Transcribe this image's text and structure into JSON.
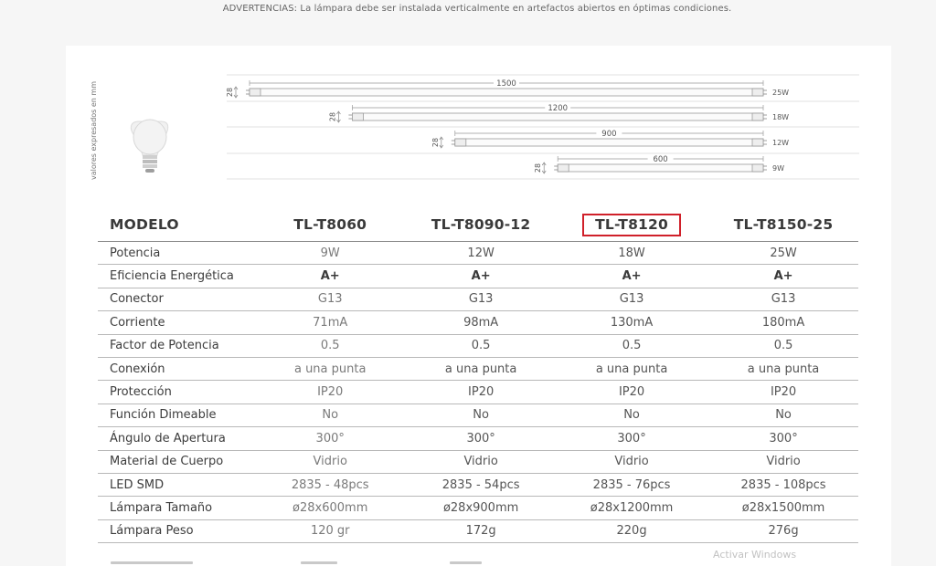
{
  "warning": {
    "text": "ADVERTENCIAS: La lámpara debe ser instalada verticalmente en artefactos abiertos en óptimas condiciones."
  },
  "diagram": {
    "side_label": "valores expresados en mm",
    "tubes": [
      {
        "diameter": "28",
        "length": "1500",
        "watt": "25W"
      },
      {
        "diameter": "28",
        "length": "1200",
        "watt": "18W"
      },
      {
        "diameter": "28",
        "length": "900",
        "watt": "12W"
      },
      {
        "diameter": "28",
        "length": "600",
        "watt": "9W"
      }
    ]
  },
  "table": {
    "header_label": "MODELO",
    "models": [
      "TL-T8060",
      "TL-T8090-12",
      "TL-T8120",
      "TL-T8150-25"
    ],
    "highlighted_model": "TL-T8120",
    "highlight_color": "#d0202a",
    "rows": [
      {
        "label": "Potencia",
        "values": [
          "9W",
          "12W",
          "18W",
          "25W"
        ]
      },
      {
        "label": "Eficiencia Energética",
        "values": [
          "A+",
          "A+",
          "A+",
          "A+"
        ],
        "bold": true
      },
      {
        "label": "Conector",
        "values": [
          "G13",
          "G13",
          "G13",
          "G13"
        ]
      },
      {
        "label": "Corriente",
        "values": [
          "71mA",
          "98mA",
          "130mA",
          "180mA"
        ]
      },
      {
        "label": "Factor de Potencia",
        "values": [
          "0.5",
          "0.5",
          "0.5",
          "0.5"
        ]
      },
      {
        "label": "Conexión",
        "values": [
          "a una punta",
          "a una punta",
          "a una punta",
          "a una punta"
        ]
      },
      {
        "label": "Protección",
        "values": [
          "IP20",
          "IP20",
          "IP20",
          "IP20"
        ]
      },
      {
        "label": "Función Dimeable",
        "values": [
          "No",
          "No",
          "No",
          "No"
        ]
      },
      {
        "label": "Ángulo de Apertura",
        "values": [
          "300°",
          "300°",
          "300°",
          "300°"
        ]
      },
      {
        "label": "Material de Cuerpo",
        "values": [
          "Vidrio",
          "Vidrio",
          "Vidrio",
          "Vidrio"
        ]
      },
      {
        "label": "LED SMD",
        "values": [
          "2835 - 48pcs",
          "2835 - 54pcs",
          "2835 - 76pcs",
          "2835 - 108pcs"
        ]
      },
      {
        "label": "Lámpara Tamaño",
        "values": [
          "ø28x600mm",
          "ø28x900mm",
          "ø28x1200mm",
          "ø28x1500mm"
        ]
      },
      {
        "label": "Lámpara Peso",
        "values": [
          "120 gr",
          "172g",
          "220g",
          "276g"
        ]
      }
    ]
  },
  "overlay": {
    "watermark": "Activar Windows"
  }
}
